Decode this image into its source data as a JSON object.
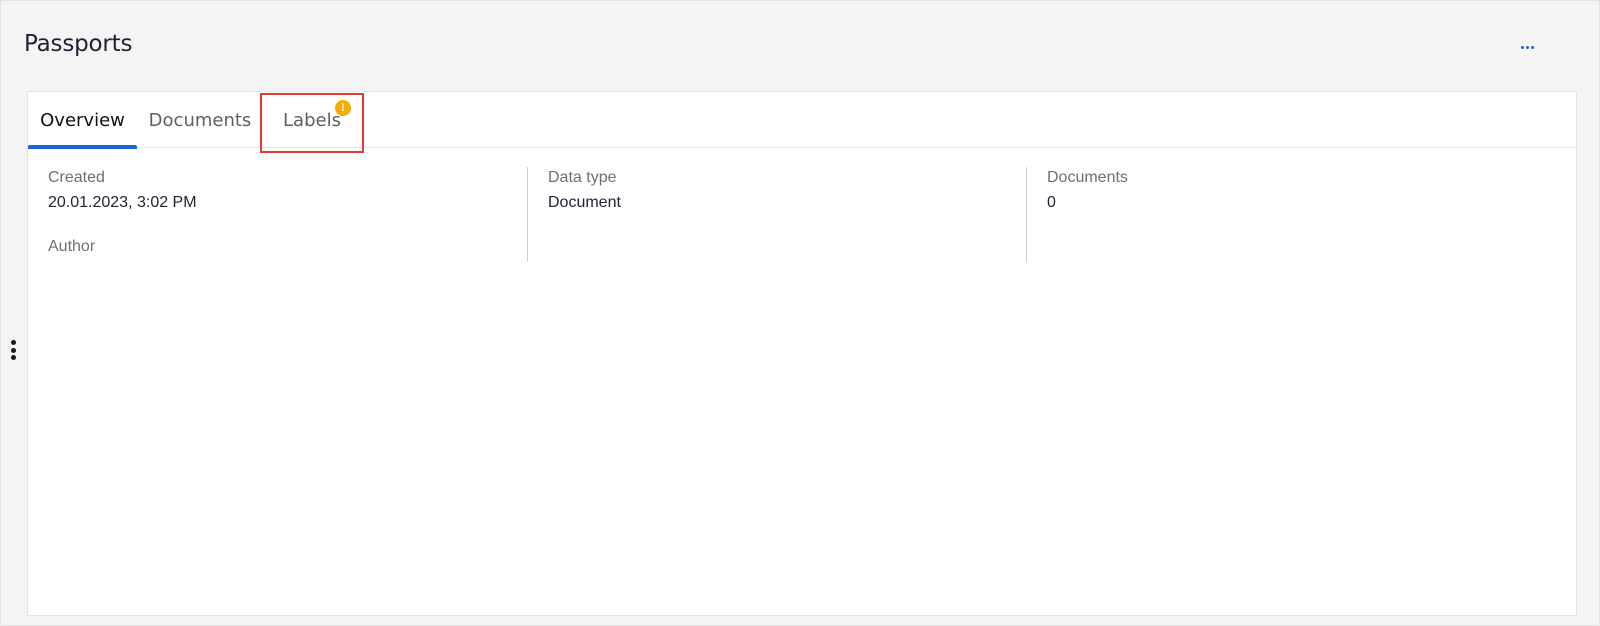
{
  "page": {
    "title": "Passports",
    "more_icon": "ellipsis-horizontal-icon",
    "side_handle_icon": "vertical-dots-handle-icon"
  },
  "tabs": [
    {
      "label": "Overview",
      "active": true
    },
    {
      "label": "Documents",
      "active": false
    },
    {
      "label": "Labels",
      "active": false,
      "badge": "!"
    }
  ],
  "overview": {
    "created_label": "Created",
    "created_value": "20.01.2023, 3:02 PM",
    "author_label": "Author",
    "data_type_label": "Data type",
    "data_type_value": "Document",
    "documents_label": "Documents",
    "documents_value": "0"
  },
  "colors": {
    "accent": "#1a66d9",
    "warning": "#f2ad00",
    "highlight": "#e53935"
  }
}
